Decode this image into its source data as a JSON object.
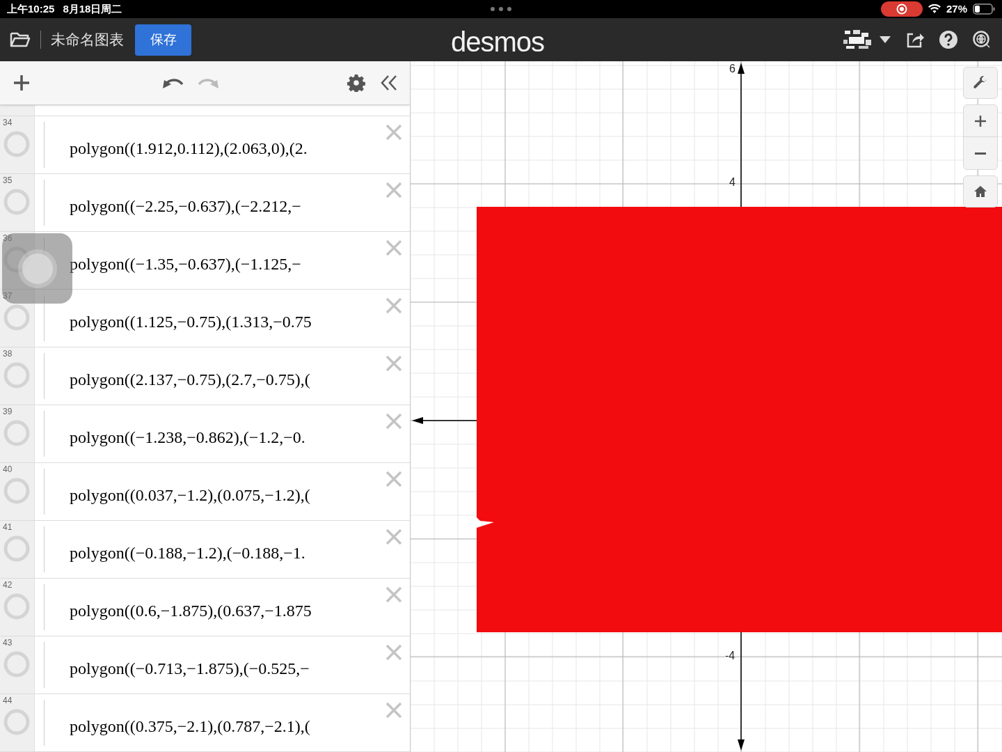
{
  "status_bar": {
    "time": "上午10:25",
    "date": "8月18日周二",
    "battery": "27%"
  },
  "header": {
    "title": "未命名图表",
    "save_button": "保存",
    "logo": "desmos"
  },
  "expressions": [
    {
      "number": "34",
      "latex": "polygon((1.912,0.112),(2.063,0),(2."
    },
    {
      "number": "35",
      "latex": "polygon((−2.25,−0.637),(−2.212,−"
    },
    {
      "number": "36",
      "latex": "polygon((−1.35,−0.637),(−1.125,−"
    },
    {
      "number": "37",
      "latex": "polygon((1.125,−0.75),(1.313,−0.75"
    },
    {
      "number": "38",
      "latex": "polygon((2.137,−0.75),(2.7,−0.75),("
    },
    {
      "number": "39",
      "latex": "polygon((−1.238,−0.862),(−1.2,−0."
    },
    {
      "number": "40",
      "latex": "polygon((0.037,−1.2),(0.075,−1.2),("
    },
    {
      "number": "41",
      "latex": "polygon((−0.188,−1.2),(−0.188,−1."
    },
    {
      "number": "42",
      "latex": "polygon((0.6,−1.875),(0.637,−1.875"
    },
    {
      "number": "43",
      "latex": "polygon((−0.713,−1.875),(−0.525,−"
    },
    {
      "number": "44",
      "latex": "polygon((0.375,−2.1),(0.787,−2.1),("
    }
  ],
  "graph": {
    "y_tick_labels": [
      {
        "label": "6",
        "kind": "top"
      },
      {
        "label": "4",
        "kind": "mid"
      },
      {
        "label": "-4",
        "kind": "mid"
      }
    ]
  }
}
